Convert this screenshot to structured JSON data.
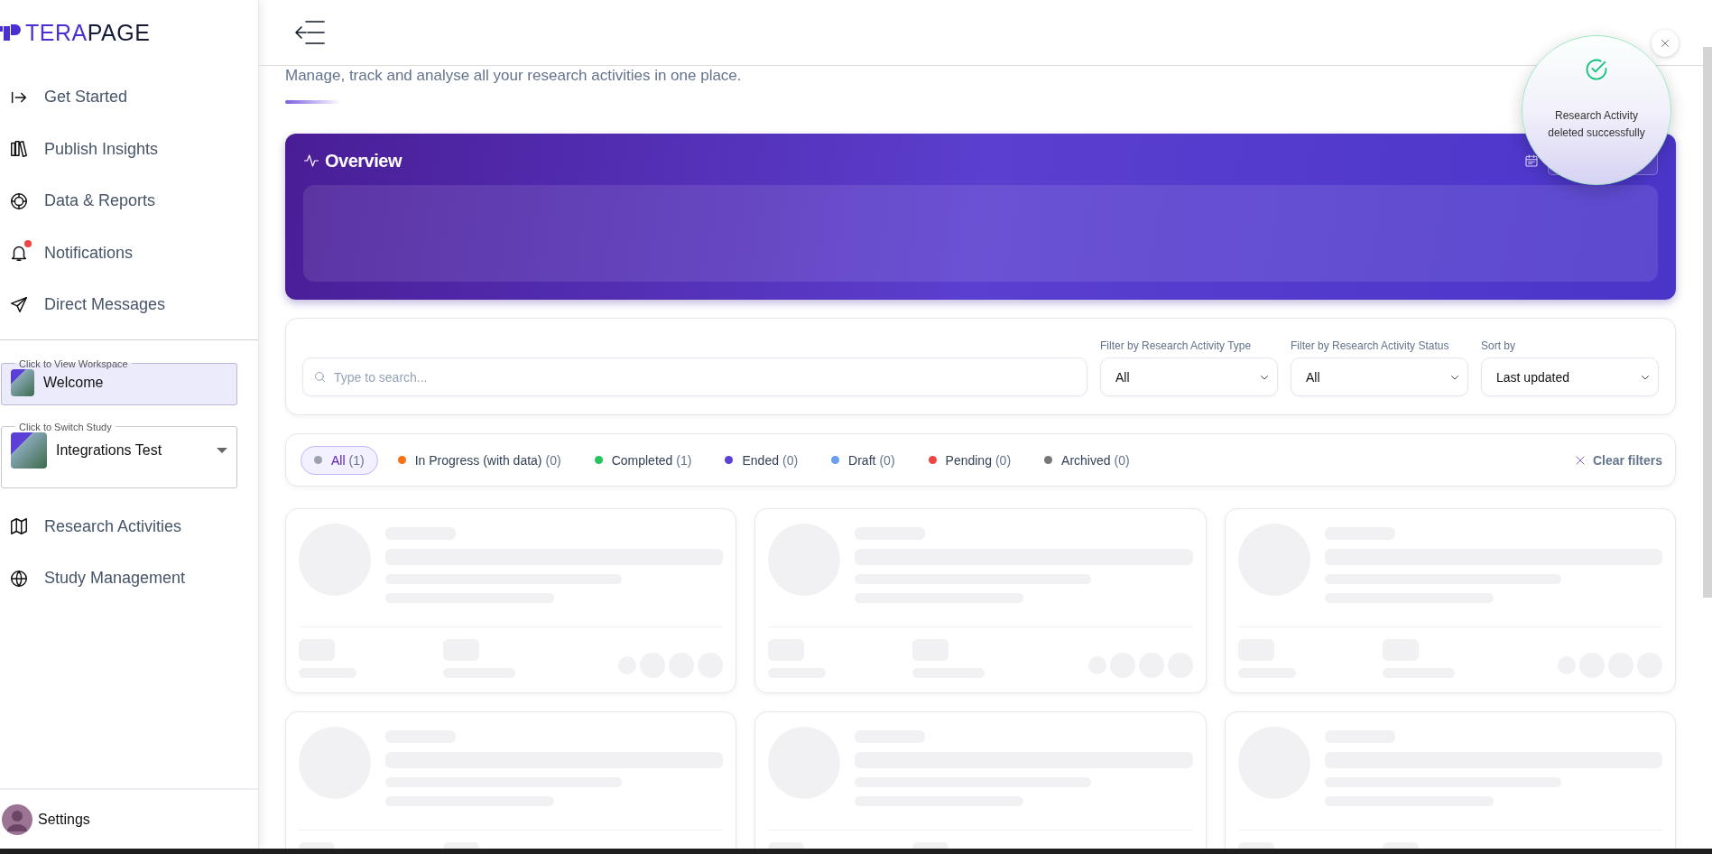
{
  "sidebar": {
    "brand": {
      "part_1": "TERA",
      "part_2": "PAGE"
    },
    "nav_top": [
      {
        "label": "Get Started",
        "unread": false
      },
      {
        "label": "Publish Insights",
        "unread": false
      },
      {
        "label": "Data & Reports",
        "unread": false
      },
      {
        "label": "Notifications",
        "unread": true
      },
      {
        "label": "Direct Messages",
        "unread": false
      }
    ],
    "workspace": {
      "legend": "Click to View Workspace",
      "value": "Welcome"
    },
    "study": {
      "legend": "Click to Switch Study",
      "value": "Integrations Test"
    },
    "nav_bottom": [
      {
        "label": "Research Activities"
      },
      {
        "label": "Study Management"
      }
    ],
    "settings": {
      "label": "Settings"
    }
  },
  "page": {
    "subtitle": "Manage, track and analyse all your research activities in one place."
  },
  "overview": {
    "title": "Overview"
  },
  "filters": {
    "search": {
      "placeholder": "Type to search..."
    },
    "selects": [
      {
        "label": "Filter by Research Activity Type",
        "value": "All"
      },
      {
        "label": "Filter by Research Activity Status",
        "value": "All"
      },
      {
        "label": "Sort by",
        "value": "Last updated"
      }
    ]
  },
  "status_chips": [
    {
      "label": "All",
      "count": "(1)",
      "color": "#9ca3af",
      "selected": true
    },
    {
      "label": "In Progress (with data)",
      "count": "(0)",
      "color": "#f97316",
      "selected": false
    },
    {
      "label": "Completed",
      "count": "(1)",
      "color": "#22c55e",
      "selected": false
    },
    {
      "label": "Ended",
      "count": "(0)",
      "color": "#5b3fd6",
      "selected": false
    },
    {
      "label": "Draft",
      "count": "(0)",
      "color": "#6b9ff0",
      "selected": false
    },
    {
      "label": "Pending",
      "count": "(0)",
      "color": "#ef4444",
      "selected": false
    },
    {
      "label": "Archived",
      "count": "(0)",
      "color": "#777777",
      "selected": false
    }
  ],
  "clear_filters": "Clear filters",
  "cards": [
    {
      "kind": "skeleton"
    },
    {
      "kind": "skeleton"
    },
    {
      "kind": "skeleton"
    },
    {
      "kind": "skeleton"
    },
    {
      "kind": "skeleton"
    },
    {
      "kind": "skeleton"
    }
  ],
  "toast": {
    "message": "Research Activity deleted successfully"
  }
}
